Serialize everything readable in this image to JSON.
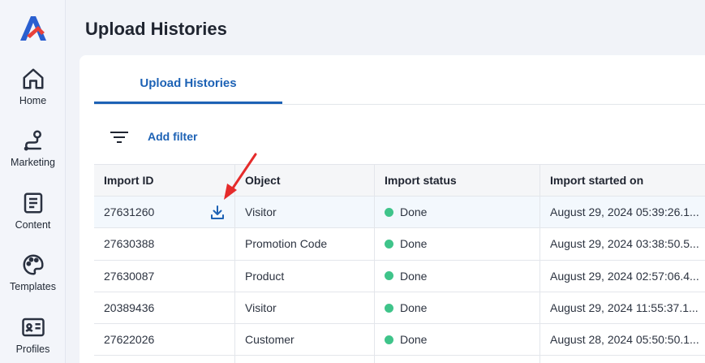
{
  "sidebar": {
    "items": [
      {
        "label": "Home",
        "icon": "home-icon"
      },
      {
        "label": "Marketing",
        "icon": "route-icon"
      },
      {
        "label": "Content",
        "icon": "document-icon"
      },
      {
        "label": "Templates",
        "icon": "palette-icon"
      },
      {
        "label": "Profiles",
        "icon": "id-card-icon"
      }
    ]
  },
  "page": {
    "title": "Upload Histories"
  },
  "tabs": [
    {
      "label": "Upload Histories",
      "active": true
    }
  ],
  "toolbar": {
    "add_filter_label": "Add filter",
    "filter_icon": "filter-icon"
  },
  "table": {
    "headers": [
      "Import ID",
      "Object",
      "Import status",
      "Import started on"
    ],
    "rows": [
      {
        "id": "27631260",
        "object": "Visitor",
        "status": "Done",
        "started": "August 29, 2024 05:39:26.1..."
      },
      {
        "id": "27630388",
        "object": "Promotion Code",
        "status": "Done",
        "started": "August 29, 2024 03:38:50.5..."
      },
      {
        "id": "27630087",
        "object": "Product",
        "status": "Done",
        "started": "August 29, 2024 02:57:06.4..."
      },
      {
        "id": "20389436",
        "object": "Visitor",
        "status": "Done",
        "started": "August 29, 2024 11:55:37.1..."
      },
      {
        "id": "27622026",
        "object": "Customer",
        "status": "Done",
        "started": "August 28, 2024 05:50:50.1..."
      }
    ]
  },
  "colors": {
    "accent": "#1d62b5",
    "status_done": "#3fc48a",
    "annotation_arrow": "#e52b2b"
  }
}
